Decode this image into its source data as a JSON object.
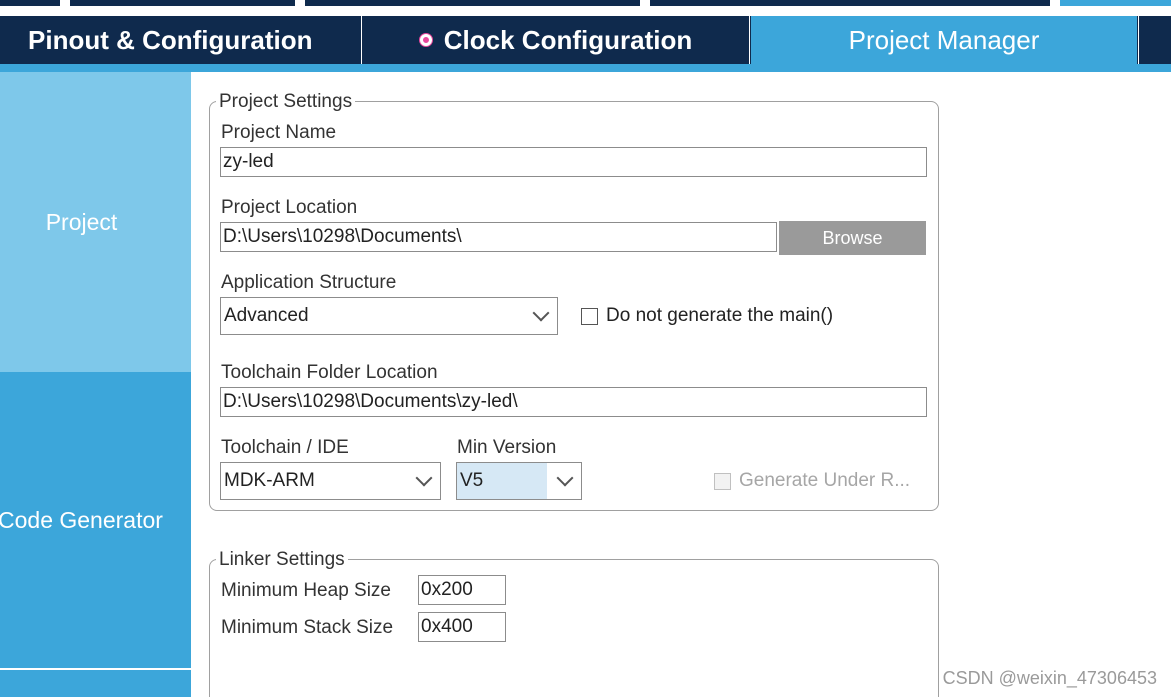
{
  "tabs": {
    "pinout": "Pinout & Configuration",
    "clock": "Clock Configuration",
    "project_manager": "Project Manager"
  },
  "sidebar": {
    "project": "Project",
    "code_generator": "Code Generator"
  },
  "project_settings": {
    "legend": "Project Settings",
    "name_label": "Project Name",
    "name_value": "zy-led",
    "location_label": "Project Location",
    "location_value": "D:\\Users\\10298\\Documents\\",
    "browse_label": "Browse",
    "app_structure_label": "Application Structure",
    "app_structure_value": "Advanced",
    "no_main_label": "Do not generate the main()",
    "toolchain_folder_label": "Toolchain Folder Location",
    "toolchain_folder_value": "D:\\Users\\10298\\Documents\\zy-led\\",
    "toolchain_label": "Toolchain / IDE",
    "toolchain_value": "MDK-ARM",
    "min_version_label": "Min Version",
    "min_version_value": "V5",
    "generate_under_root_label": "Generate Under R..."
  },
  "linker_settings": {
    "legend": "Linker Settings",
    "heap_label": "Minimum Heap Size",
    "heap_value": "0x200",
    "stack_label": "Minimum Stack Size",
    "stack_value": "0x400"
  },
  "watermark": "CSDN @weixin_47306453",
  "colors": {
    "dark_navy": "#0f2a4d",
    "accent_blue": "#3ca6da",
    "light_blue": "#7ec8ea",
    "clock_dot": "#e8479c"
  },
  "icons": {
    "clock_status": "pink-dot-icon",
    "dropdown": "chevron-down-icon"
  }
}
